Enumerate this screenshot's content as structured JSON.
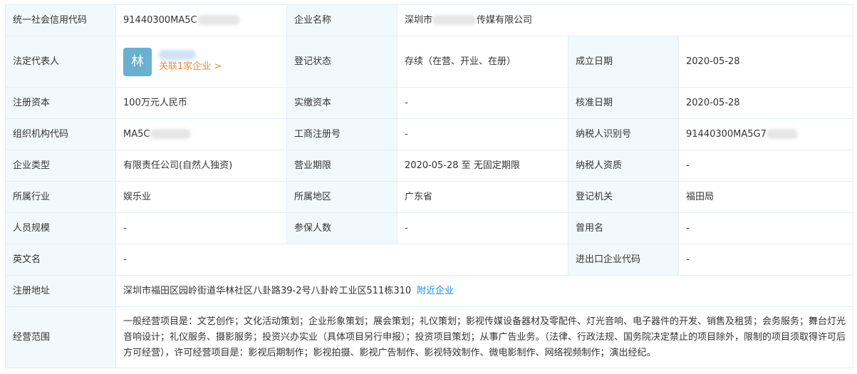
{
  "labels": {
    "credit_code": "统一社会信用代码",
    "company_name": "企业名称",
    "legal_rep": "法定代表人",
    "reg_status": "登记状态",
    "founded": "成立日期",
    "reg_capital": "注册资本",
    "paid_capital": "实缴资本",
    "approved_date": "核准日期",
    "org_code": "组织机构代码",
    "biz_reg_no": "工商注册号",
    "taxpayer_id": "纳税人识别号",
    "company_type": "企业类型",
    "biz_term": "营业期限",
    "taxpayer_qual": "纳税人资质",
    "industry": "所属行业",
    "region": "所属地区",
    "authority": "登记机关",
    "staff_size": "人员规模",
    "insured": "参保人数",
    "former_name": "曾用名",
    "english_name": "英文名",
    "ie_code": "进出口企业代码",
    "address": "注册地址",
    "scope": "经营范围"
  },
  "values": {
    "credit_code": "91440300MA5C",
    "company_name_prefix": "深圳市",
    "company_name_suffix": "传媒有限公司",
    "legal_rep_avatar": "林",
    "legal_rep_link": "关联1家企业 >",
    "reg_status": "存续（在营、开业、在册）",
    "founded": "2020-05-28",
    "reg_capital": "100万元人民币",
    "paid_capital": "-",
    "approved_date": "2020-05-28",
    "org_code": "MA5C",
    "biz_reg_no": "-",
    "taxpayer_id": "91440300MA5G7",
    "company_type": "有限责任公司(自然人独资)",
    "biz_term": "2020-05-28 至 无固定期限",
    "taxpayer_qual": "-",
    "industry": "娱乐业",
    "region": "广东省",
    "authority": "福田局",
    "staff_size": "-",
    "insured": "-",
    "former_name": "-",
    "english_name": "-",
    "ie_code": "-",
    "address": "深圳市福田区园岭街道华林社区八卦路39-2号八卦岭工业区511栋310",
    "address_link": "附近企业",
    "scope": "一般经营项目是：文艺创作；文化活动策划；企业形象策划；展会策划；礼仪策划；影视传媒设备器材及零配件、灯光音响、电子器件的开发、销售及租赁；会务服务；舞台灯光音响设计；礼仪服务、摄影服务；投资兴办实业（具体项目另行申报）；投资项目策划；从事广告业务。（法律、行政法规、国务院决定禁止的项目除外，限制的项目须取得许可后方可经营），许可经营项目是：影视后期制作；影视拍摄、影视广告制作、影视特效制作、微电影制作、网络视频制作；演出经纪。"
  },
  "colors": {
    "label_bg": "#f2f9fc",
    "border": "#e4eef6",
    "link_blue": "#128bed",
    "link_orange": "#f0883a",
    "avatar_bg": "#6ab0cf"
  }
}
